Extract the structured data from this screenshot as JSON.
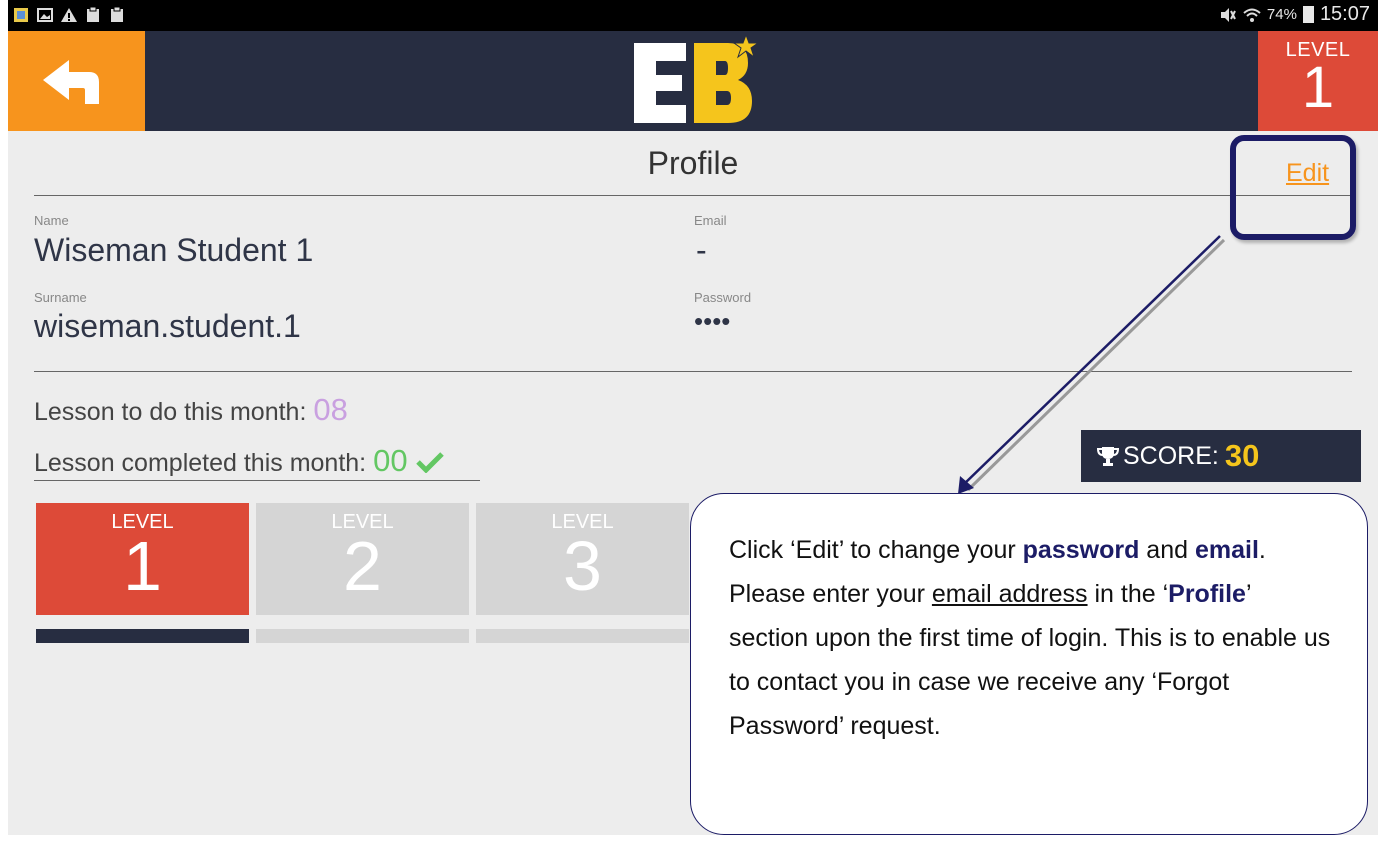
{
  "status_bar": {
    "signal_text": "74%",
    "time": "15:07"
  },
  "header": {
    "level_label": "LEVEL",
    "level_number": "1",
    "colors": {
      "bar": "#272d41",
      "back": "#f7941d",
      "level": "#dd4a38"
    }
  },
  "profile": {
    "title": "Profile",
    "edit_label": "Edit",
    "name_label": "Name",
    "name_value": "Wiseman Student 1",
    "surname_label": "Surname",
    "surname_value": "wiseman.student.1",
    "email_label": "Email",
    "email_value": "-",
    "password_label": "Password",
    "password_value": "••••"
  },
  "lessons": {
    "todo_label": "Lesson to do this month: ",
    "todo_value": "08",
    "completed_label": "Lesson completed this month: ",
    "completed_value": "00"
  },
  "score": {
    "label": "SCORE: ",
    "value": "30"
  },
  "levels": [
    {
      "label": "LEVEL",
      "number": "1",
      "active": true
    },
    {
      "label": "LEVEL",
      "number": "2",
      "active": false
    },
    {
      "label": "LEVEL",
      "number": "3",
      "active": false
    }
  ],
  "callout": {
    "t1": "Click ‘Edit’ to change your ",
    "b1": "password",
    "t2": " and ",
    "b2": "email",
    "t3": ". Please enter your ",
    "u1": "email address",
    "t4": " in the ‘",
    "b3": "Profile",
    "t5": "’ section upon the first time of login. This is to enable us to contact you in case we receive any ‘Forgot Password’ request."
  }
}
